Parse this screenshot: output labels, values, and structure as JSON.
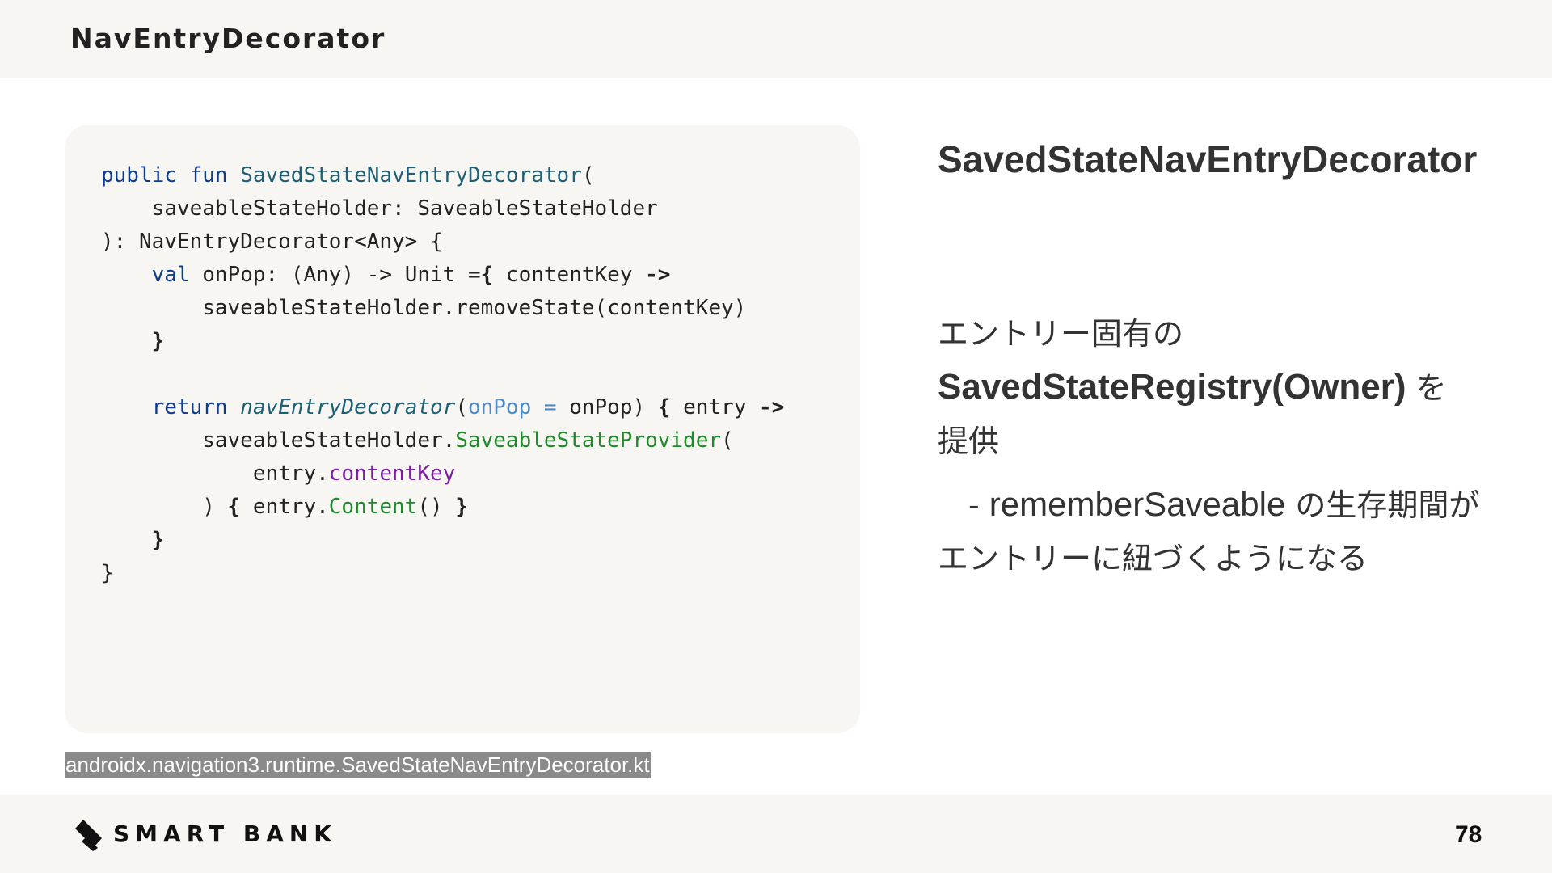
{
  "header": {
    "title": "NavEntryDecorator"
  },
  "code": {
    "lines": [
      [
        {
          "t": "public fun ",
          "c": "kw"
        },
        {
          "t": "SavedStateNavEntryDecorator",
          "c": "fn"
        },
        {
          "t": "("
        }
      ],
      [
        {
          "t": "    saveableStateHolder: SaveableStateHolder"
        }
      ],
      [
        {
          "t": "): NavEntryDecorator<Any> {"
        }
      ],
      [
        {
          "t": "    "
        },
        {
          "t": "val ",
          "c": "kw"
        },
        {
          "t": "onPop: (Any) -> Unit ="
        },
        {
          "t": "{",
          "c": "b"
        },
        {
          "t": " contentKey "
        },
        {
          "t": "->",
          "c": "b"
        }
      ],
      [
        {
          "t": "        saveableStateHolder.removeState(contentKey)"
        }
      ],
      [
        {
          "t": "    "
        },
        {
          "t": "}",
          "c": "b"
        }
      ],
      [
        {
          "t": ""
        }
      ],
      [
        {
          "t": "    "
        },
        {
          "t": "return ",
          "c": "kw"
        },
        {
          "t": "navEntryDecorator",
          "c": "fi"
        },
        {
          "t": "("
        },
        {
          "t": "onPop = ",
          "c": "pn"
        },
        {
          "t": "onPop) "
        },
        {
          "t": "{",
          "c": "b"
        },
        {
          "t": " entry "
        },
        {
          "t": "->",
          "c": "b"
        }
      ],
      [
        {
          "t": "        saveableStateHolder."
        },
        {
          "t": "SaveableStateProvider",
          "c": "gr"
        },
        {
          "t": "("
        }
      ],
      [
        {
          "t": "            entry."
        },
        {
          "t": "contentKey",
          "c": "pr"
        }
      ],
      [
        {
          "t": "        ) "
        },
        {
          "t": "{",
          "c": "b"
        },
        {
          "t": " entry."
        },
        {
          "t": "Content",
          "c": "gr"
        },
        {
          "t": "() "
        },
        {
          "t": "}",
          "c": "b"
        }
      ],
      [
        {
          "t": "    "
        },
        {
          "t": "}",
          "c": "b"
        }
      ],
      [
        {
          "t": "}"
        }
      ]
    ]
  },
  "source_caption": "androidx.navigation3.runtime.SavedStateNavEntryDecorator.kt",
  "right": {
    "title": "SavedStateNavEntryDecorator",
    "line1": "エントリー固有の",
    "registry_term": "SavedStateRegistry(Owner)",
    "line2_suffix": " を",
    "line3": "提供",
    "sub_prefix": "　- ",
    "sub_term": "rememberSaveable",
    "sub_rest": " の生存期間がエントリーに紐づくようになる"
  },
  "footer": {
    "brand": "SMART BANK",
    "page_number": "78"
  },
  "colors": {
    "keyword": "#0e3b8c",
    "function": "#1d5f75",
    "param": "#4a8cc9",
    "property": "#7b1fa2",
    "composable": "#1f8a2c",
    "panel": "#f7f6f3"
  },
  "icons": {
    "brand_logo": "smartbank-slash-logo-icon"
  }
}
